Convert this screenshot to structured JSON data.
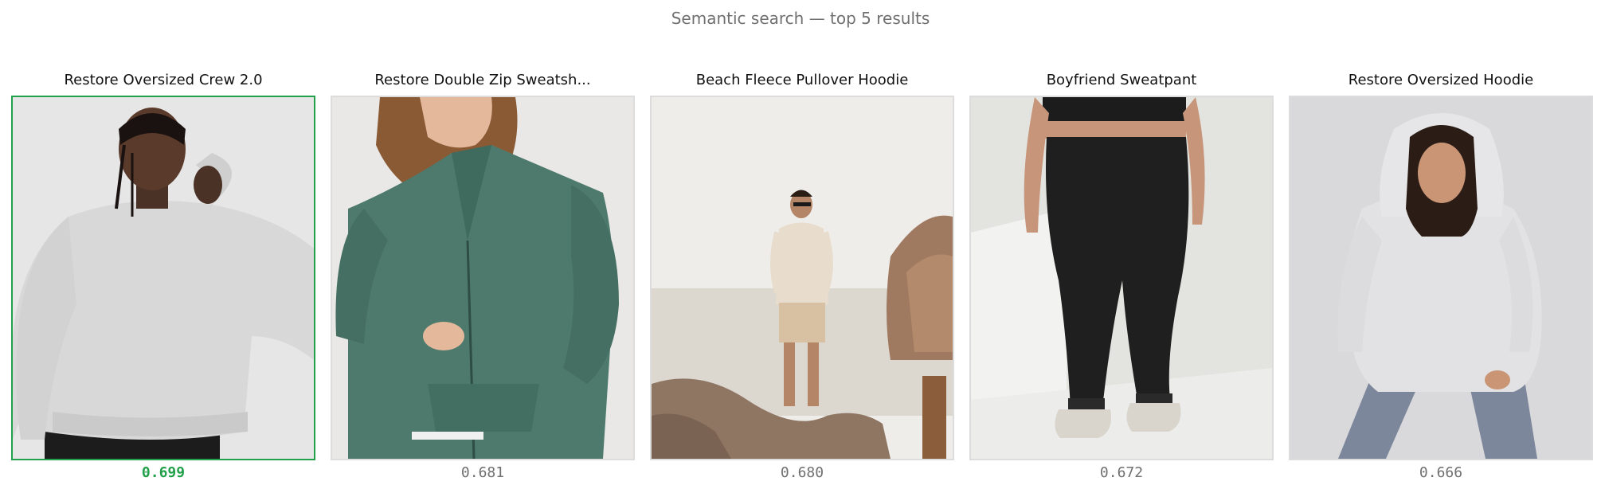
{
  "page": {
    "title": "Semantic search — top 5 results"
  },
  "colors": {
    "best_match": "#22a04a",
    "muted_text": "#707070",
    "frame_border": "#dcdcdc"
  },
  "results": [
    {
      "title": "Restore Oversized Crew 2.0",
      "score": "0.699",
      "top_match": true,
      "image": "light heather grey oversized crewneck sweatshirt on male model"
    },
    {
      "title": "Restore Double Zip Sweatsh...",
      "score": "0.681",
      "top_match": false,
      "image": "sage green full-zip sweatshirt on female model"
    },
    {
      "title": "Beach Fleece Pullover Hoodie",
      "score": "0.680",
      "top_match": false,
      "image": "man in cream hoodie and shorts standing on rocky beach"
    },
    {
      "title": "Boyfriend Sweatpant",
      "score": "0.672",
      "top_match": false,
      "image": "black sweatpants with white sneakers in white room"
    },
    {
      "title": "Restore Oversized Hoodie",
      "score": "0.666",
      "top_match": false,
      "image": "light grey oversized hoodie on female model with grey leggings"
    }
  ]
}
